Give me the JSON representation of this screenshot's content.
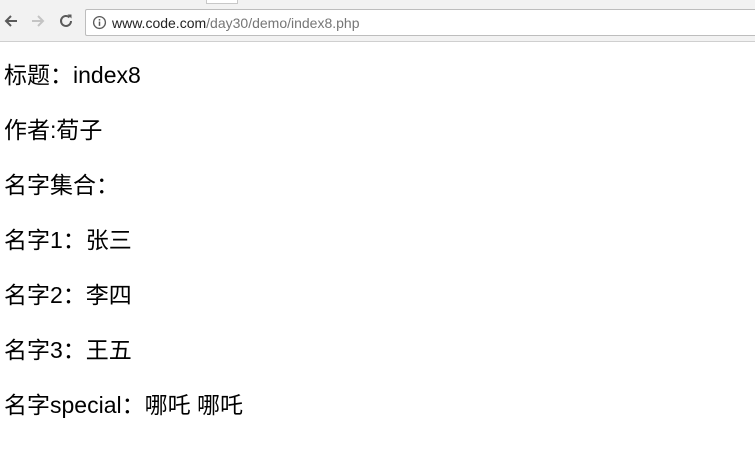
{
  "browser": {
    "url_host": "www.code.com",
    "url_path": "/day30/demo/index8.php"
  },
  "page": {
    "lines": [
      {
        "label": "标题：",
        "value": "index8"
      },
      {
        "label": "作者:",
        "value": "荀子"
      },
      {
        "label": "名字集合：",
        "value": ""
      },
      {
        "label": "名字1：",
        "value": "张三"
      },
      {
        "label": "名字2：",
        "value": "李四"
      },
      {
        "label": "名字3：",
        "value": "王五"
      },
      {
        "label": "名字special：",
        "value": "哪吒 哪吒"
      }
    ]
  },
  "icons": {
    "back": "arrow-left-icon",
    "forward": "arrow-right-icon",
    "reload": "reload-icon",
    "info": "info-icon"
  }
}
